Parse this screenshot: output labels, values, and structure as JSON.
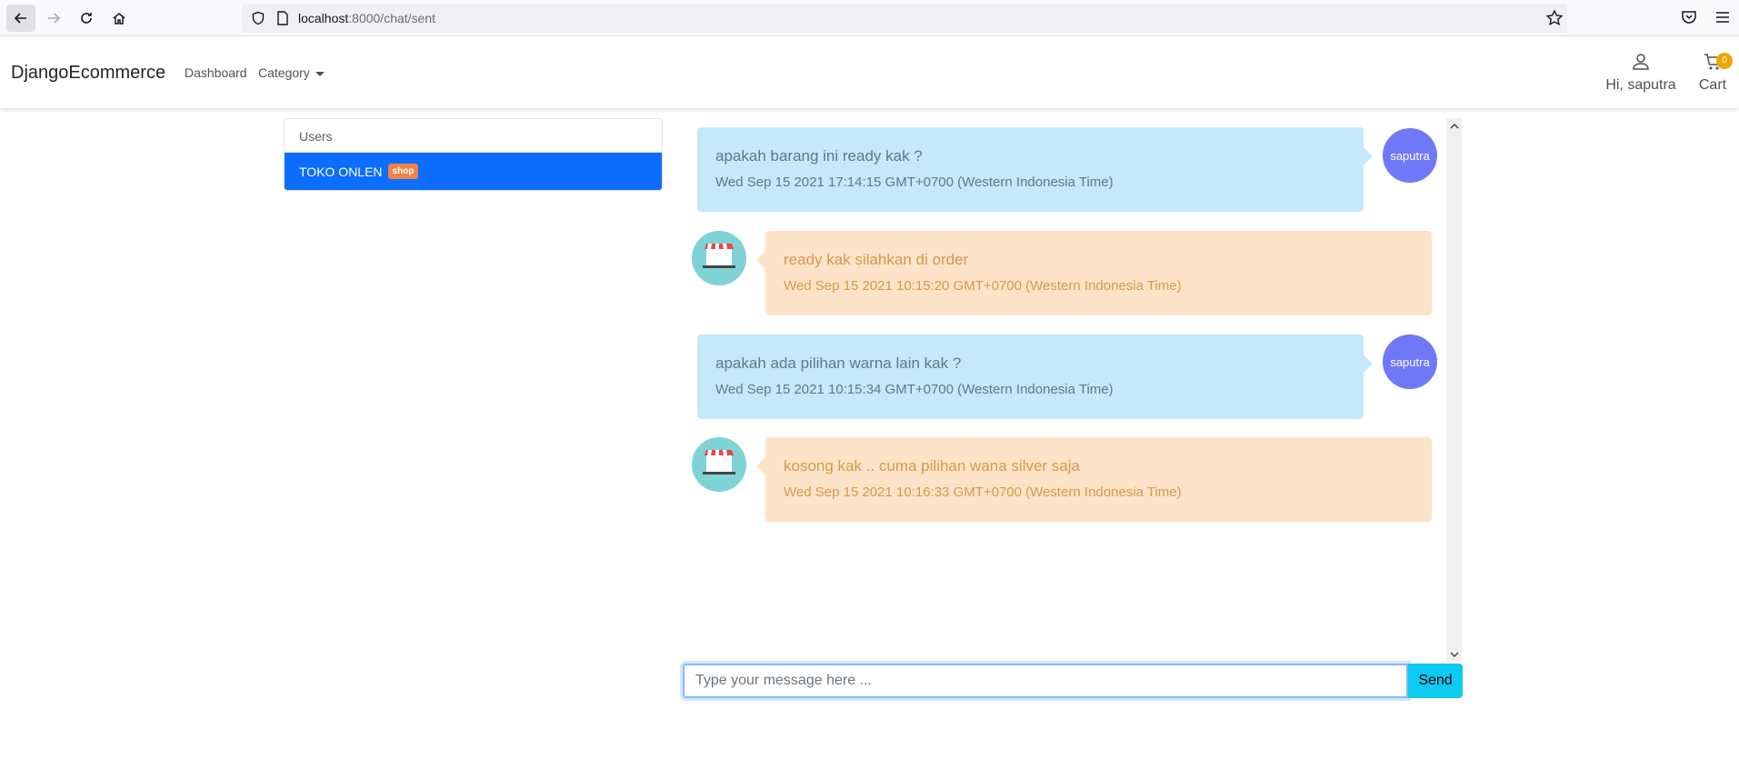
{
  "browser": {
    "url_host": "localhost",
    "url_rest": ":8000/chat/sent"
  },
  "navbar": {
    "brand": "DjangoEcommerce",
    "links": [
      "Dashboard",
      "Category"
    ],
    "user_greeting": "Hi, saputra",
    "cart_label": "Cart",
    "cart_count": "0"
  },
  "users_panel": {
    "header": "Users",
    "items": [
      {
        "name": "TOKO ONLEN",
        "badge": "shop",
        "active": true
      }
    ]
  },
  "chat": {
    "messages": [
      {
        "side": "sent",
        "text": "apakah barang ini ready kak ?",
        "time": "Wed Sep 15 2021 17:14:15 GMT+0700 (Western Indonesia Time)",
        "avatar": "saputra"
      },
      {
        "side": "received",
        "text": "ready kak silahkan di order",
        "time": "Wed Sep 15 2021 10:15:20 GMT+0700 (Western Indonesia Time)",
        "avatar": "shop-logo"
      },
      {
        "side": "sent",
        "text": "apakah ada pilihan warna lain kak ?",
        "time": "Wed Sep 15 2021 10:15:34 GMT+0700 (Western Indonesia Time)",
        "avatar": "saputra"
      },
      {
        "side": "received",
        "text": "kosong kak .. cuma pilihan wana silver saja",
        "time": "Wed Sep 15 2021 10:16:33 GMT+0700 (Western Indonesia Time)",
        "avatar": "shop-logo"
      }
    ]
  },
  "input": {
    "placeholder": "Type your message here ...",
    "value": "",
    "send_label": "Send"
  },
  "colors": {
    "sent_bubble": "#c5e8fa",
    "received_bubble": "#fde3c7",
    "user_avatar": "#6f79f8",
    "active_user": "#0d6efd",
    "send_button": "#0dcaf0",
    "shop_badge": "#f0834a"
  }
}
